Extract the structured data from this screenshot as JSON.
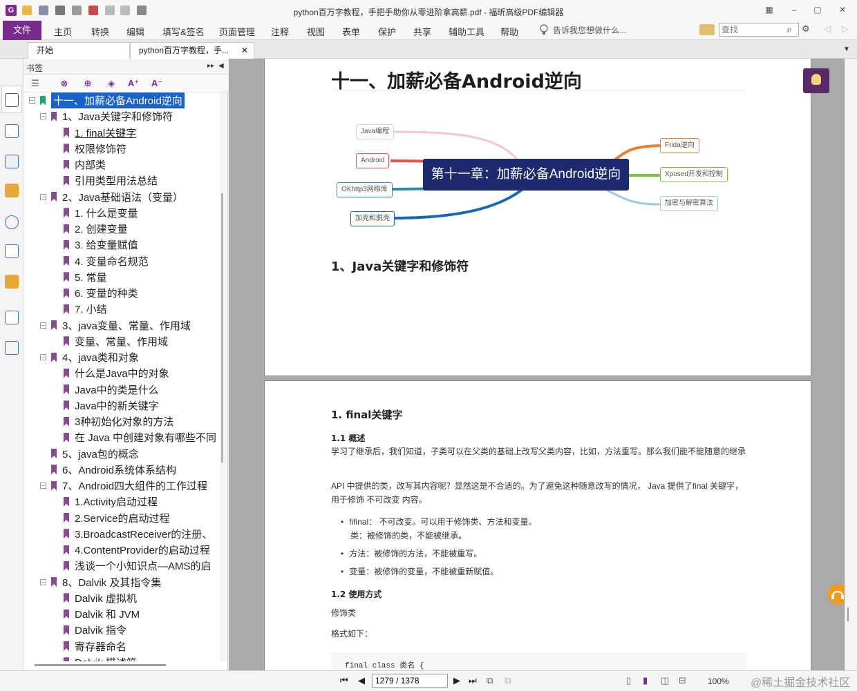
{
  "window": {
    "title": "python百万字教程，手把手助你从零进阶拿高薪.pdf - 福昕高级PDF编辑器",
    "logo": "G"
  },
  "menu": {
    "file": "文件",
    "items": [
      "主页",
      "转换",
      "编辑",
      "填写&签名",
      "页面管理",
      "注释",
      "视图",
      "表单",
      "保护",
      "共享",
      "辅助工具",
      "帮助"
    ],
    "tellme": "告诉我您想做什么...",
    "find_placeholder": "查找"
  },
  "tabs": [
    {
      "label": "开始"
    },
    {
      "label": "python百万字教程，手..."
    }
  ],
  "bookmarks": {
    "panel_title": "书签",
    "items": [
      {
        "label": "十一、加薪必备Android逆向",
        "level": 0
      },
      {
        "label": "1、Java关键字和修饰符",
        "level": 1
      },
      {
        "label": "1. final关键字",
        "level": 2
      },
      {
        "label": "权限修饰符",
        "level": 2
      },
      {
        "label": "内部类",
        "level": 2
      },
      {
        "label": "引用类型用法总结",
        "level": 2
      },
      {
        "label": "2、Java基础语法（变量）",
        "level": 1
      },
      {
        "label": "1. 什么是变量",
        "level": 2
      },
      {
        "label": "2. 创建变量",
        "level": 2
      },
      {
        "label": "3. 给变量赋值",
        "level": 2
      },
      {
        "label": "4. 变量命名规范",
        "level": 2
      },
      {
        "label": "5. 常量",
        "level": 2
      },
      {
        "label": "6. 变量的种类",
        "level": 2
      },
      {
        "label": "7. 小结",
        "level": 2
      },
      {
        "label": "3、java变量、常量、作用域",
        "level": 1
      },
      {
        "label": "变量、常量、作用域",
        "level": 2
      },
      {
        "label": "4、java类和对象",
        "level": 1
      },
      {
        "label": "什么是Java中的对象",
        "level": 2
      },
      {
        "label": "Java中的类是什么",
        "level": 2
      },
      {
        "label": "Java中的新关键字",
        "level": 2
      },
      {
        "label": "3种初始化对象的方法",
        "level": 2
      },
      {
        "label": "在 Java 中创建对象有哪些不同",
        "level": 2
      },
      {
        "label": "5、java包的概念",
        "level": 1
      },
      {
        "label": "6、Android系统体系结构",
        "level": 1
      },
      {
        "label": "7、Android四大组件的工作过程",
        "level": 1
      },
      {
        "label": "1.Activity启动过程",
        "level": 2
      },
      {
        "label": "2.Service的启动过程",
        "level": 2
      },
      {
        "label": "3.BroadcastReceiver的注册、",
        "level": 2
      },
      {
        "label": "4.ContentProvider的启动过程",
        "level": 2
      },
      {
        "label": "浅谈一个小知识点—AMS的启",
        "level": 2
      },
      {
        "label": "8、Dalvik 及其指令集",
        "level": 1
      },
      {
        "label": "Dalvik 虚拟机",
        "level": 2
      },
      {
        "label": "Dalvik 和 JVM",
        "level": 2
      },
      {
        "label": "Dalvik 指令",
        "level": 2
      },
      {
        "label": "寄存器命名",
        "level": 2
      },
      {
        "label": "Dalvik 描述符",
        "level": 2
      }
    ]
  },
  "page1": {
    "chapter_title": "十一、加薪必备Android逆向",
    "mindmap": {
      "center": "第十一章：加薪必备Android逆向",
      "left": [
        "Java编程",
        "Android",
        "OKhttp3网络库",
        "加壳和脱壳"
      ],
      "right": [
        "Frida逆向",
        "Xposed开发和控制",
        "加密与解密算法"
      ]
    },
    "section_title": "1、Java关键字和修饰符"
  },
  "page2": {
    "h_final": "1. final关键字",
    "h_overview": "1.1 概述",
    "p1": "学习了继承后，我们知道，子类可以在父类的基础上改写父类内容，比如，方法重写。那么我们能不能随意的继承",
    "p2": "API 中提供的类，改写其内容呢？显然这是不合适的。为了避免这种随意改写的情况， Java 提供了final 关键字，用于修饰 不可改变 内容。",
    "bullets": [
      {
        "main": "fifinal： 不可改变。可以用于修饰类、方法和变量。",
        "sub": "类：被修饰的类，不能被继承。"
      },
      {
        "main": "方法：被修饰的方法，不能被重写。",
        "sub": ""
      },
      {
        "main": "变量：被修饰的变量，不能被重新赋值。",
        "sub": ""
      }
    ],
    "h_usage": "1.2 使用方式",
    "modifier_class": "修饰类",
    "format_label": "格式如下：",
    "code": "final class 类名 {"
  },
  "status": {
    "page_indicator": "1279 / 1378",
    "zoom": "100%",
    "watermark": "@稀土掘金技术社区"
  },
  "colors": {
    "accent": "#7a2c8e",
    "selection": "#1b62c8",
    "mindmap_center": "#1d2a6f"
  }
}
